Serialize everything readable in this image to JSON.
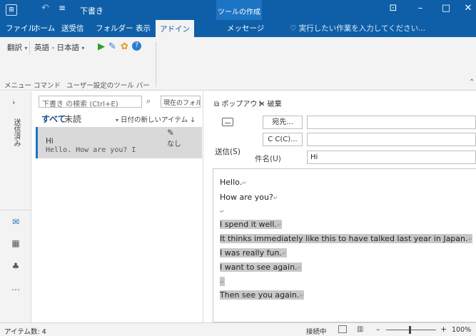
{
  "titlebar": {
    "qa_customize": "≡",
    "title": "下書き",
    "context_group": "ツールの作成",
    "icons": [
      "outlook-app-icon",
      "undo-icon",
      "ribbon-display-icon",
      "minimize-icon",
      "maximize-icon",
      "close-icon"
    ]
  },
  "tabs": [
    "ファイル",
    "ホーム",
    "送受信",
    "フォルダー",
    "表示",
    "アドイン",
    "メッセージ"
  ],
  "active_tab": "アドイン",
  "tell_me": "実行したい作業を入力してください...",
  "ribbon": {
    "translate": "翻訳",
    "language_pair": "英語 - 日本語",
    "group_menu_commands": "メニュー コマンド",
    "group_custom_toolbars": "ユーザー設定のツール バー"
  },
  "nav": {
    "folder_label": "送信済み"
  },
  "list": {
    "search_placeholder": "下書き の検索 (Ctrl+E)",
    "scope": "現在のフォルダー",
    "filter_all": "すべて",
    "filter_unread": "未読",
    "sort": "日付の新しいアイテム",
    "sort_arrow": "↓",
    "message": {
      "from": "Hi",
      "preview": "Hello. How are you? I",
      "date": "なし"
    }
  },
  "compose": {
    "popout": "ポップアウト",
    "discard": "破棄",
    "send": "送信(S)",
    "to_button": "宛先...",
    "cc_button": "C C(C)...",
    "subject_label": "件名(U)",
    "subject_value": "Hi",
    "body": [
      {
        "text": "Hello.",
        "selected": false
      },
      {
        "text": "How are you?",
        "selected": false
      },
      {
        "text": "",
        "selected": false
      },
      {
        "text": "I spend it well.",
        "selected": true
      },
      {
        "text": "It thinks immediately like this to have talked last year in Japan.",
        "selected": true
      },
      {
        "text": "I was really fun.",
        "selected": true
      },
      {
        "text": "I want to see again.",
        "selected": true
      },
      {
        "text": "",
        "selected": true
      },
      {
        "text": "Then see you again.",
        "selected": true
      }
    ]
  },
  "status": {
    "item_count": "アイテム数: 4",
    "connection": "接続中",
    "zoom": "100%"
  },
  "colors": {
    "titlebar": "#0f5fa8",
    "accent": "#1a73c9",
    "selection": "#c8c8c8"
  }
}
